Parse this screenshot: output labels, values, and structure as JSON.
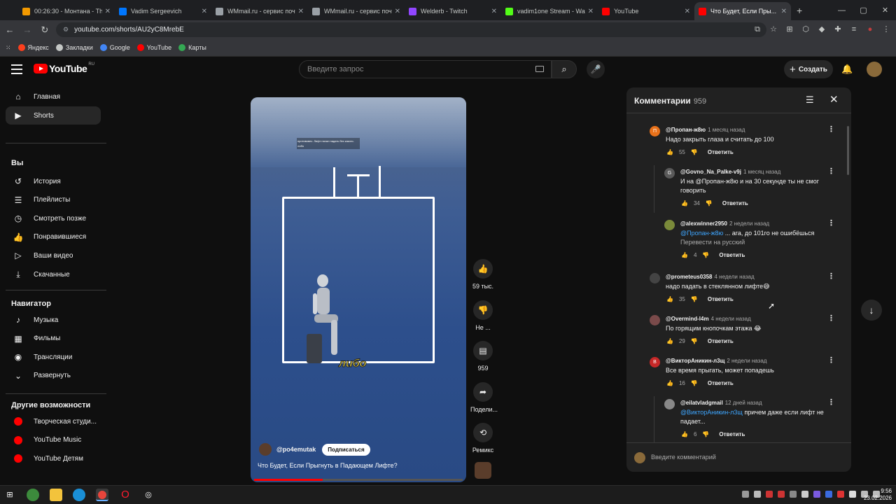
{
  "browser": {
    "tabs": [
      {
        "label": "00:26:30 - Монтана - The...",
        "color": "#f29900"
      },
      {
        "label": "Vadim Sergeevich",
        "color": "#0077ff"
      },
      {
        "label": "WMmail.ru - сервис почт...",
        "color": "#9aa0a6"
      },
      {
        "label": "WMmail.ru - сервис почт...",
        "color": "#9aa0a6"
      },
      {
        "label": "Welderb - Twitch",
        "color": "#9146ff"
      },
      {
        "label": "vadim1one Stream - Watc...",
        "color": "#53fc18"
      },
      {
        "label": "YouTube",
        "color": "#ff0000"
      },
      {
        "label": "Что Будет, Если Пры...",
        "color": "#ff0000"
      }
    ],
    "url": "youtube.com/shorts/AU2yC8MrebE",
    "bookmarks": [
      {
        "label": "Яндекс",
        "color": "#fc3f1d"
      },
      {
        "label": "Закладки",
        "color": "#c4c7c5"
      },
      {
        "label": "Google",
        "color": "#4285f4"
      },
      {
        "label": "YouTube",
        "color": "#ff0000"
      },
      {
        "label": "Карты",
        "color": "#34a853"
      }
    ]
  },
  "header": {
    "logo_text": "YouTube",
    "logo_region": "RU",
    "search_placeholder": "Введите запрос",
    "create_label": "Создать"
  },
  "sidebar": {
    "main": [
      {
        "label": "Главная",
        "icon": "home-icon",
        "glyph": "⌂"
      },
      {
        "label": "Shorts",
        "icon": "shorts-icon",
        "glyph": "▶"
      }
    ],
    "you_heading": "Вы",
    "you": [
      {
        "label": "История",
        "icon": "history-icon",
        "glyph": "↺"
      },
      {
        "label": "Плейлисты",
        "icon": "playlists-icon",
        "glyph": "☰"
      },
      {
        "label": "Смотреть позже",
        "icon": "watch-later-icon",
        "glyph": "◷"
      },
      {
        "label": "Понравившиеся",
        "icon": "like-icon",
        "glyph": "👍"
      },
      {
        "label": "Ваши видео",
        "icon": "your-videos-icon",
        "glyph": "▷"
      },
      {
        "label": "Скачанные",
        "icon": "download-icon",
        "glyph": "⤓"
      }
    ],
    "nav_heading": "Навигатор",
    "nav": [
      {
        "label": "Музыка",
        "icon": "music-icon",
        "glyph": "♪"
      },
      {
        "label": "Фильмы",
        "icon": "film-icon",
        "glyph": "▦"
      },
      {
        "label": "Трансляции",
        "icon": "live-icon",
        "glyph": "◉"
      },
      {
        "label": "Развернуть",
        "icon": "chevron-down-icon",
        "glyph": "⌄"
      }
    ],
    "more_heading": "Другие возможности",
    "more": [
      {
        "label": "Творческая студи...",
        "icon": "studio-icon"
      },
      {
        "label": "YouTube Music",
        "icon": "yt-music-icon"
      },
      {
        "label": "YouTube Детям",
        "icon": "yt-kids-icon"
      }
    ]
  },
  "video": {
    "caption": "противовес. Лифт начал падать без какого-либо",
    "subtitle": "либо",
    "channel": "@po4emutak",
    "subscribe": "Подписаться",
    "title": "Что Будет, Если Прыгнуть в Падающем Лифте?",
    "progress": 0.33
  },
  "actions": [
    {
      "name": "like-button",
      "icon": "like-icon",
      "glyph": "👍",
      "label": "59 тыс."
    },
    {
      "name": "dislike-button",
      "icon": "dislike-icon",
      "glyph": "👎",
      "label": "Не ..."
    },
    {
      "name": "comments-button",
      "icon": "comment-icon",
      "glyph": "▤",
      "label": "959"
    },
    {
      "name": "share-button",
      "icon": "share-icon",
      "glyph": "➦",
      "label": "Подели..."
    },
    {
      "name": "remix-button",
      "icon": "remix-icon",
      "glyph": "⟲",
      "label": "Ремикс"
    }
  ],
  "comments_panel": {
    "title": "Комментарии",
    "count": "959",
    "input_placeholder": "Введите комментарий",
    "comments": [
      {
        "author": "@Пропан-ж8ю",
        "time": "1 месяц назад",
        "mention": "",
        "text": "Надо закрыть глаза и считать до 100",
        "extra": "",
        "likes": "55",
        "reply": "Ответить",
        "initial": "П",
        "color": "#e8711a",
        "level": 0
      },
      {
        "author": "@Govno_Na_Palke-v9j",
        "time": "1 месяц назад",
        "mention": "",
        "text": "И на @Пропан-ж8ю и на 30 секунде ты не смог говорить",
        "extra": "",
        "likes": "34",
        "reply": "Ответить",
        "initial": "G",
        "color": "#5a5a5a",
        "level": 1
      },
      {
        "author": "@alexwinner2950",
        "time": "2 недели назад",
        "mention": "@Пропан-ж8ю",
        "text": "... ага, до 101го не ошибёшься",
        "extra": "Перевести на русский",
        "likes": "4",
        "reply": "Ответить",
        "initial": "",
        "color": "#7a8a3a",
        "level": 1
      },
      {
        "author": "@prometeus0358",
        "time": "4 недели назад",
        "mention": "",
        "text": "надо падать в стеклянном лифте😅",
        "extra": "",
        "likes": "35",
        "reply": "Ответить",
        "initial": "",
        "color": "#444",
        "level": 0
      },
      {
        "author": "@Overmind-l4m",
        "time": "4 недели назад",
        "mention": "",
        "text": "По горящим кнопочкам этажа 😂",
        "extra": "",
        "likes": "29",
        "reply": "Ответить",
        "initial": "",
        "color": "#7a4a4a",
        "level": 0
      },
      {
        "author": "@ВикторАникин-л3щ",
        "time": "2 недели назад",
        "mention": "",
        "text": "Все время прыгать, может попадешь",
        "extra": "",
        "likes": "16",
        "reply": "Ответить",
        "initial": "В",
        "color": "#c62828",
        "level": 0
      },
      {
        "author": "@eilatvladgmail",
        "time": "12 дней назад",
        "mention": "@ВикторАникин-л3щ",
        "text": "причем даже если лифт не падает...",
        "extra": "",
        "likes": "6",
        "reply": "Ответить",
        "initial": "",
        "color": "#888",
        "level": 1
      }
    ]
  },
  "taskbar": {
    "time": "9:56",
    "date": "23.02.2026"
  }
}
